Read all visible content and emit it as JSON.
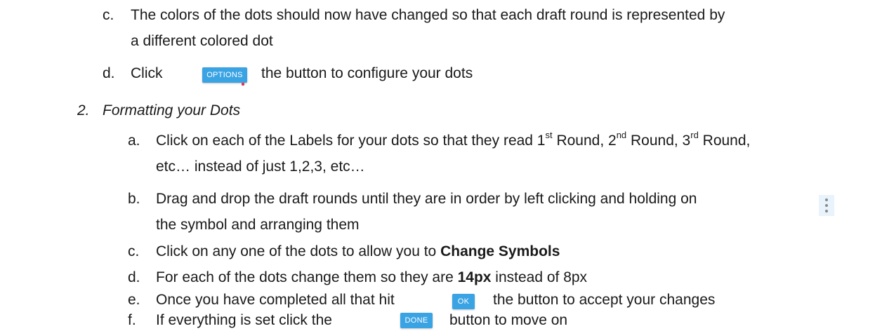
{
  "step1": {
    "c": {
      "marker": "c.",
      "line1": "The colors of the dots should now have changed so that each draft round is represented by",
      "line2": "a different colored dot"
    },
    "d": {
      "marker": "d.",
      "prefix": "Click",
      "button": "OPTIONS",
      "suffix": "the button to configure your dots"
    }
  },
  "section2": {
    "number": "2.",
    "title": "Formatting your Dots"
  },
  "step2": {
    "a": {
      "marker": "a.",
      "p1": "Click on each of the Labels for your dots so that they read 1",
      "sup1": "st",
      "p2": " Round, 2",
      "sup2": "nd",
      "p3": " Round, 3",
      "sup3": "rd",
      "p4": " Round,",
      "line2": "etc… instead of just 1,2,3, etc…"
    },
    "b": {
      "marker": "b.",
      "line1": "Drag and drop the draft rounds until they are in order by left clicking and holding on",
      "line2": "the  symbol and arranging them"
    },
    "c": {
      "marker": "c.",
      "prefix": "Click on any one of the dots to allow you to ",
      "bold": "Change Symbols"
    },
    "d": {
      "marker": "d.",
      "prefix": "For each of the dots change them so they are ",
      "bold": "14px",
      "suffix": " instead of 8px"
    },
    "e": {
      "marker": "e.",
      "prefix": "Once you have completed all that hit",
      "button": "OK",
      "suffix": "the button to accept your changes"
    },
    "f": {
      "marker": "f.",
      "prefix": "If everything is set click the",
      "button": "DONE",
      "suffix": "button to move on"
    }
  },
  "colors": {
    "button": "#3aa3e3",
    "button_text": "#ffffff",
    "kebab_bg": "#e8f3fb",
    "kebab_dot": "#8a8a8a"
  },
  "icons": {
    "kebab": "vertical-ellipsis-icon"
  }
}
